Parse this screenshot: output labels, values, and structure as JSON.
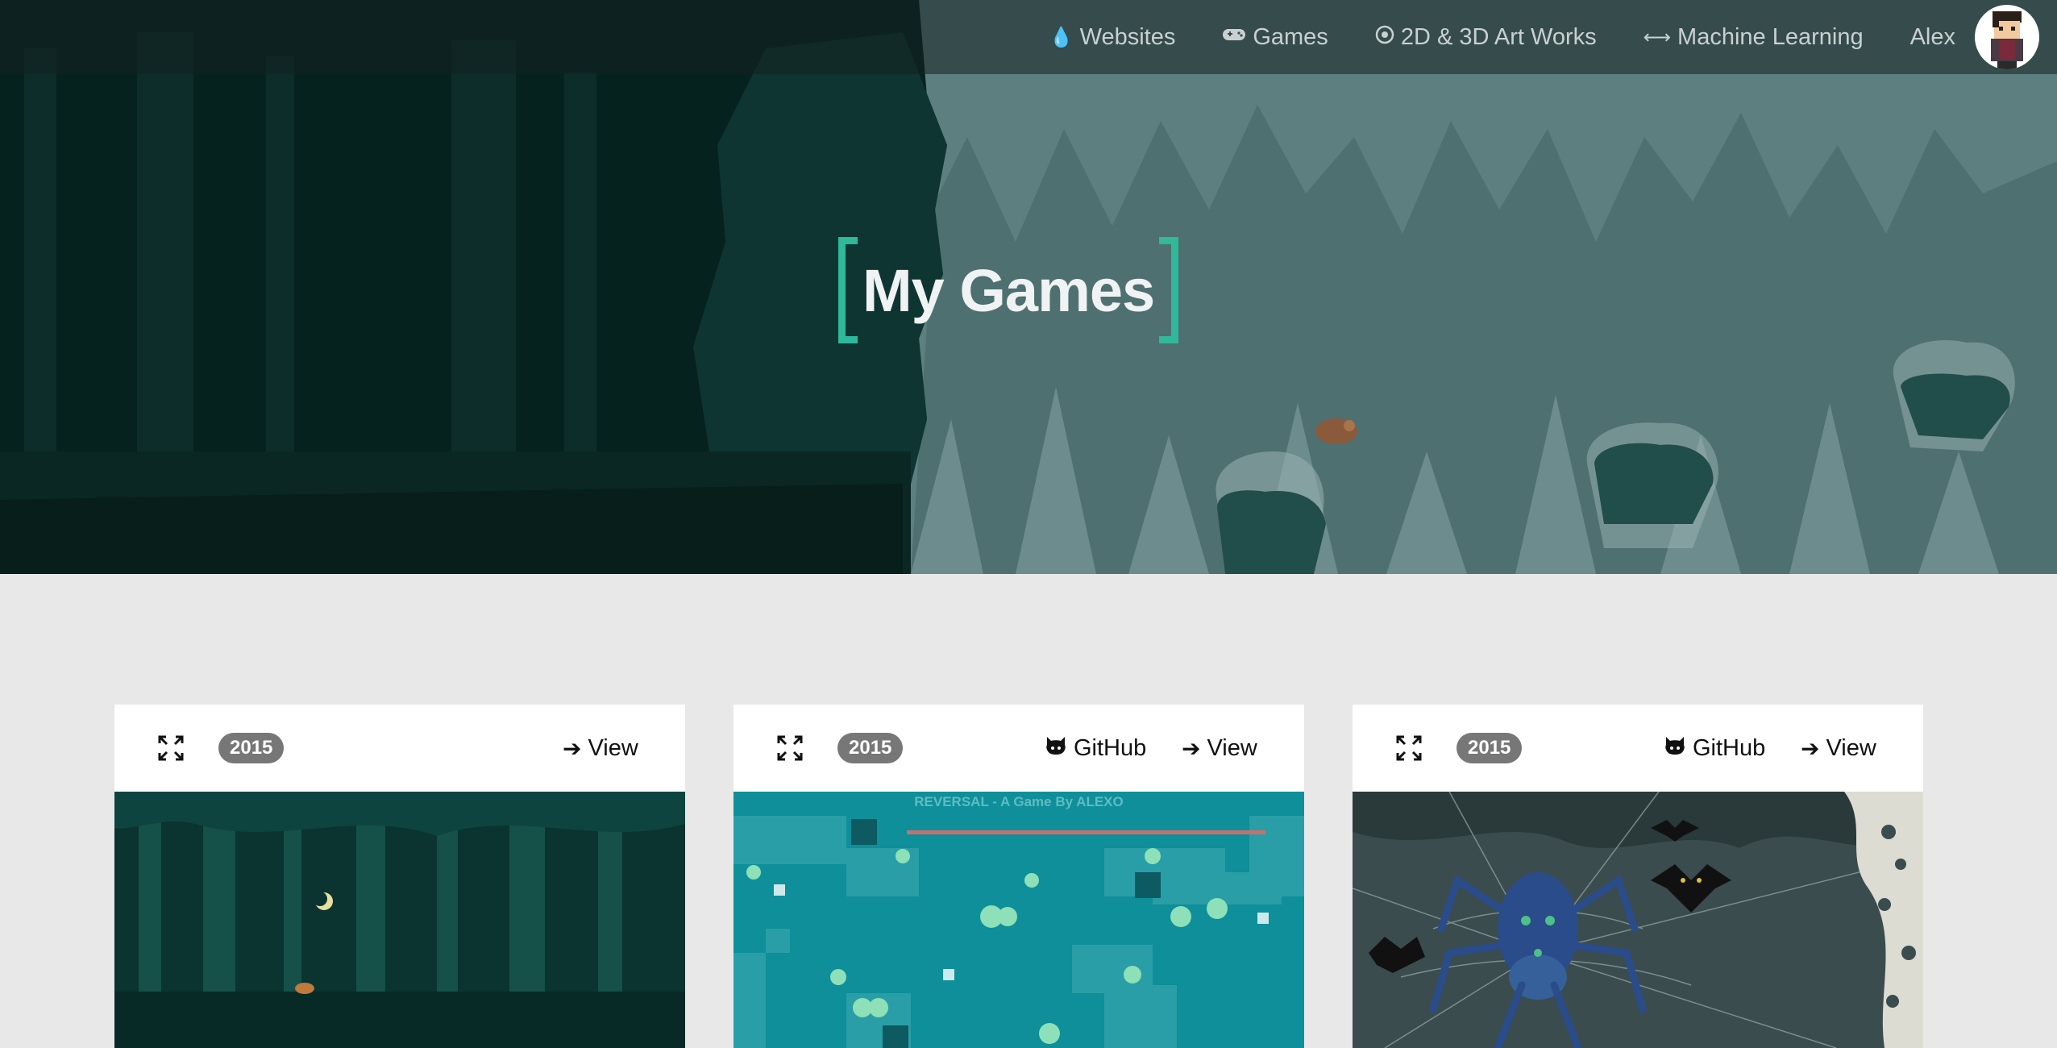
{
  "nav": {
    "items": [
      {
        "label": "Websites",
        "icon": "drupal-icon"
      },
      {
        "label": "Games",
        "icon": "gamepad-icon"
      },
      {
        "label": "2D & 3D Art Works",
        "icon": "target-icon"
      },
      {
        "label": "Machine Learning",
        "icon": "arrows-h-icon"
      }
    ],
    "user": "Alex"
  },
  "hero": {
    "title": "My Games"
  },
  "cards": [
    {
      "year": "2015",
      "view_label": "View",
      "github_label": null,
      "thumbnail": "forest-game-screenshot"
    },
    {
      "year": "2015",
      "view_label": "View",
      "github_label": "GitHub",
      "thumbnail": "reversal-game-screenshot",
      "caption": "REVERSAL - A Game By ALEXO"
    },
    {
      "year": "2015",
      "view_label": "View",
      "github_label": "GitHub",
      "thumbnail": "spider-cave-game-screenshot"
    }
  ],
  "colors": {
    "accent": "#2fb89a",
    "badge": "#777777",
    "page_bg": "#e8e8e8"
  }
}
